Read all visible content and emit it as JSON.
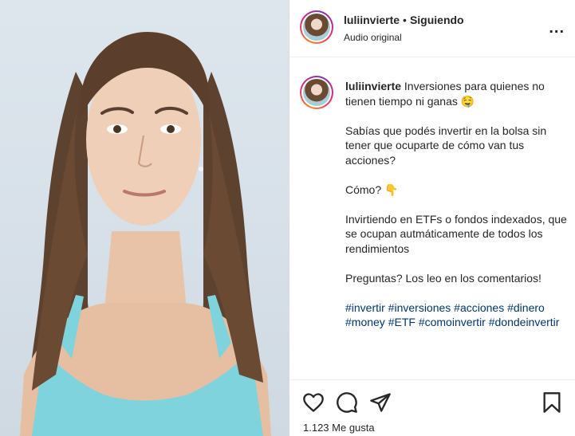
{
  "header": {
    "username": "luliinvierte",
    "separator": "•",
    "follow_status": "Siguiendo",
    "audio": "Audio original",
    "more_glyph": "..."
  },
  "caption": {
    "username": "luliinvierte",
    "line1": "Inversiones para quienes no tienen tiempo ni ganas 🤤",
    "para2": "Sabías que podés invertir en la bolsa sin tener que ocuparte de cómo van tus acciones?",
    "para3": "Cómo? 👇",
    "para4": "Invirtiendo en ETFs o fondos indexados, que se ocupan autmáticamente de todos los rendimientos",
    "para5": "Preguntas? Los leo en los comentarios!",
    "hashtags": "#invertir #inversiones #acciones #dinero #money #ETF #comoinvertir #dondeinvertir"
  },
  "footer": {
    "likes": "1.123 Me gusta"
  },
  "icons": {
    "like": "heart-icon",
    "comment": "comment-icon",
    "share": "send-icon",
    "save": "bookmark-icon"
  },
  "colors": {
    "story_ring": "#dd2a7b",
    "text": "#262626",
    "hashtag": "#00376b",
    "top_background": "#dde6ed",
    "shirt": "#7fd3dc"
  }
}
